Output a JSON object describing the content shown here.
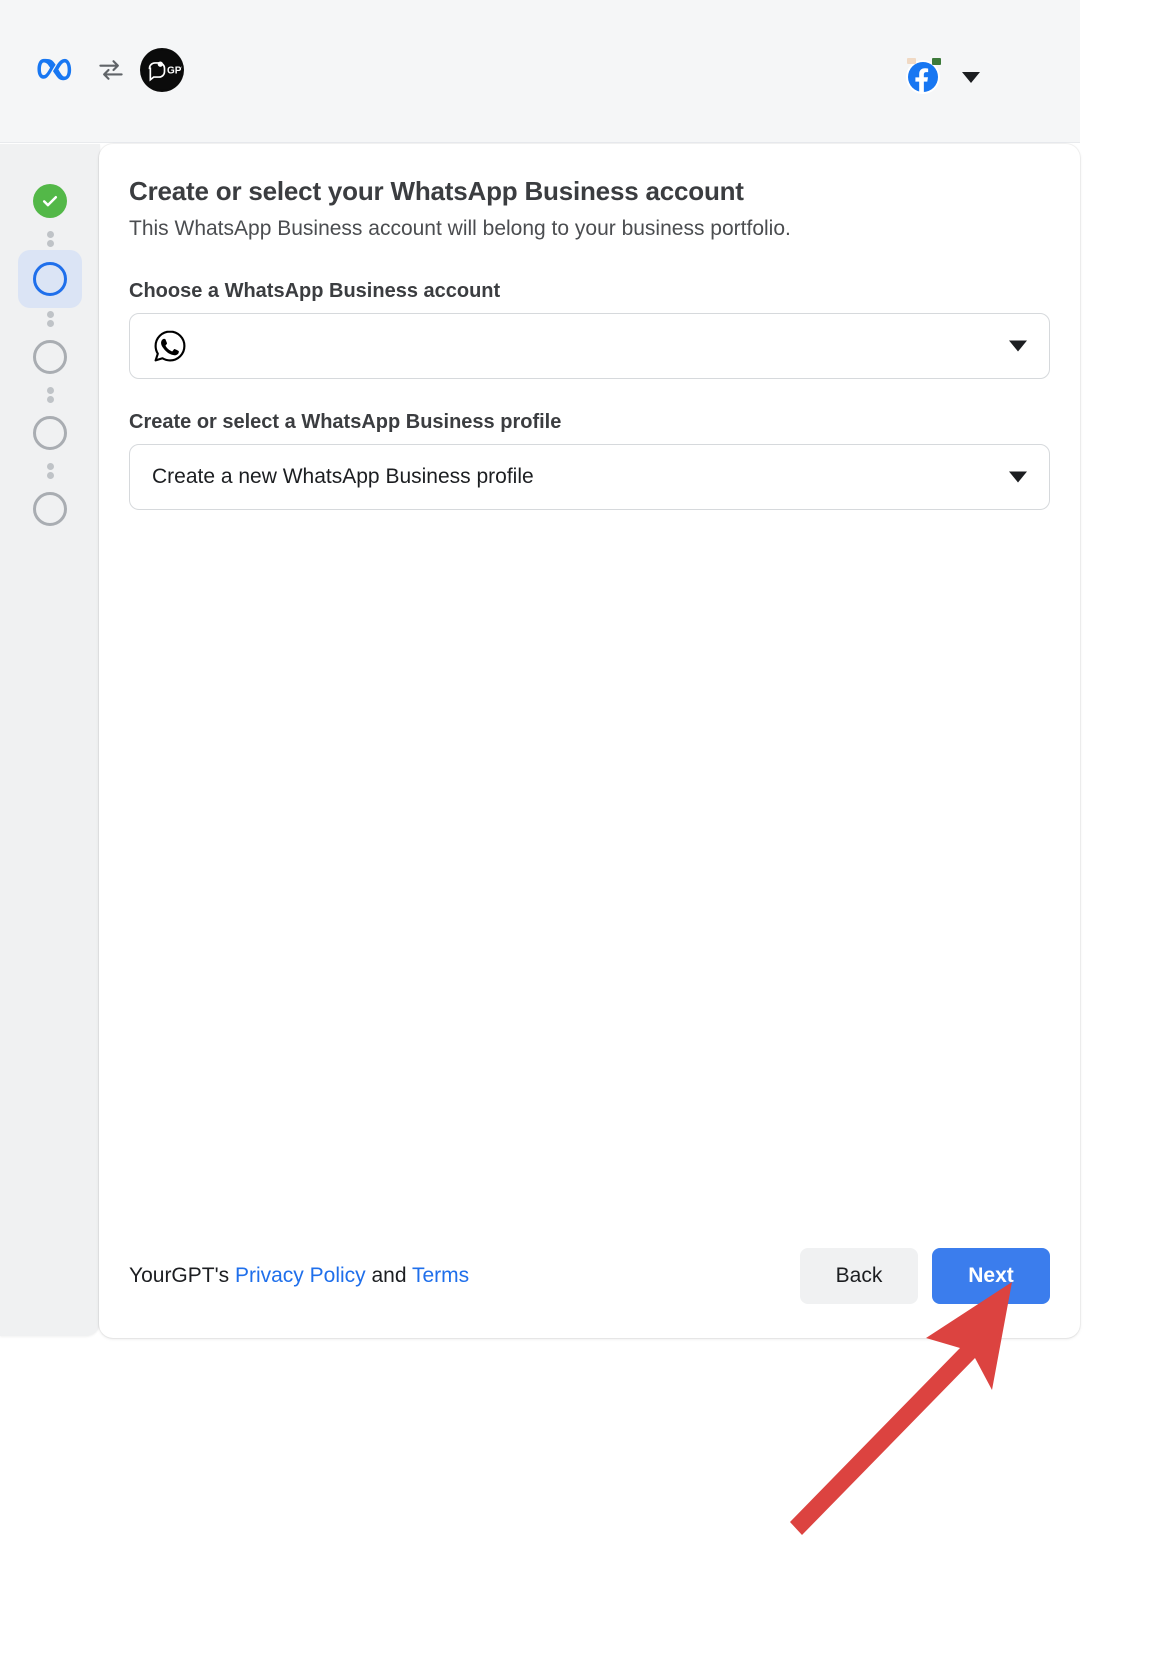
{
  "header": {
    "meta_logo": "meta-logo-icon",
    "sync_icon": "sync-arrows-icon",
    "app_logo": "yourgpt-logo-icon",
    "app_logo_text": "GPT",
    "account_avatar": "facebook-avatar-icon",
    "account_caret": "chevron-down-icon"
  },
  "stepper": {
    "steps": [
      {
        "name": "step-1",
        "state": "completed",
        "icon": "check-icon"
      },
      {
        "name": "step-2",
        "state": "current",
        "icon": "circle-icon"
      },
      {
        "name": "step-3",
        "state": "pending",
        "icon": "circle-icon"
      },
      {
        "name": "step-4",
        "state": "pending",
        "icon": "circle-icon"
      },
      {
        "name": "step-5",
        "state": "pending",
        "icon": "circle-icon"
      }
    ]
  },
  "main": {
    "title": "Create or select your WhatsApp Business account",
    "subtitle": "This WhatsApp Business account will belong to your business portfolio.",
    "fields": [
      {
        "label": "Choose a WhatsApp Business account",
        "value": "",
        "icon": "whatsapp-icon",
        "caret": "caret-down-icon"
      },
      {
        "label": "Create or select a WhatsApp Business profile",
        "value": "Create a new WhatsApp Business profile",
        "icon": "",
        "caret": "caret-down-icon"
      }
    ]
  },
  "footer": {
    "legal_prefix": "YourGPT's ",
    "privacy_link": "Privacy Policy",
    "legal_middle": " and ",
    "terms_link": "Terms",
    "back_label": "Back",
    "next_label": "Next"
  },
  "annotation": {
    "arrow": "red-arrow-pointing-to-next-button",
    "color": "#dc4340"
  },
  "colors": {
    "primary_button": "#3b7ded",
    "link": "#1f6feb",
    "step_done": "#53b848",
    "step_active": "#1f6feb",
    "step_pending": "#a9adb2",
    "header_bg": "#f5f6f7",
    "sidebar_bg": "#f0f1f2",
    "card_bg": "#ffffff"
  }
}
